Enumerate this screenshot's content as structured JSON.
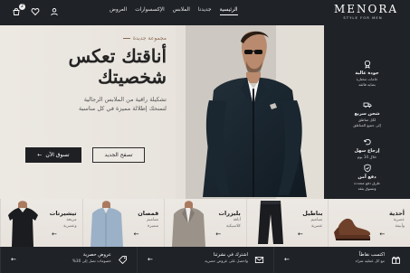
{
  "header": {
    "brand_name": "MENORA",
    "brand_tagline": "STYLE FOR MEN",
    "nav": [
      {
        "label": "الرئيسية",
        "active": true
      },
      {
        "label": "جديدنا",
        "active": false
      },
      {
        "label": "الملابس",
        "active": false
      },
      {
        "label": "الإكسسوارات",
        "active": false
      },
      {
        "label": "العروض",
        "active": false
      }
    ],
    "icons": {
      "cart": "cart-icon",
      "wishlist": "heart-icon",
      "account": "user-icon"
    },
    "cart_count": "2"
  },
  "hero": {
    "eyebrow": "مجموعة جديدة",
    "title_line1": "أناقتك تعكس",
    "title_line2": "شخصيتك",
    "subtitle_line1": "تشكيلة راقية من الملابس الرجالية",
    "subtitle_line2": "لتمنحك إطلالة مميزة في كل مناسبة",
    "primary_button": "تسوق الآن",
    "secondary_button": "تصفح الجديد"
  },
  "features": [
    {
      "title": "جودة عالية",
      "desc_line1": "خامات مختارة",
      "desc_line2": "بعناية فائقة",
      "icon": "badge-icon"
    },
    {
      "title": "شحن سريع",
      "desc_line1": "لكل مناطق",
      "desc_line2": "إلى جميع المناطق",
      "icon": "truck-icon"
    },
    {
      "title": "إرجاع سهل",
      "desc_line1": "خلال 14 يوم",
      "desc_line2": "",
      "icon": "return-icon"
    },
    {
      "title": "دفع آمن",
      "desc_line1": "طرق دفع متعددة",
      "desc_line2": "وتسوق بثقة",
      "icon": "secure-payment-icon"
    }
  ],
  "categories": [
    {
      "title": "أحذية",
      "sub_line1": "عصرية",
      "sub_line2": "وأنيقة",
      "art": "shoe"
    },
    {
      "title": "بناطيل",
      "sub_line1": "تصاميم",
      "sub_line2": "عصرية",
      "art": "pants"
    },
    {
      "title": "بليزرات",
      "sub_line1": "أناقة",
      "sub_line2": "كلاسيكية",
      "art": "blazer"
    },
    {
      "title": "قمصان",
      "sub_line1": "تصاميم",
      "sub_line2": "متميزة",
      "art": "shirt"
    },
    {
      "title": "تيشيرتات",
      "sub_line1": "مريحة",
      "sub_line2": "وعصرية",
      "art": "tshirt"
    }
  ],
  "bottom_bar": [
    {
      "title": "اكتسب نقاطاً",
      "desc": "مع كل عملية شراء",
      "icon": "gift-icon"
    },
    {
      "title": "اشترك في نشرتنا",
      "desc": "واحصل على عروض حصرية",
      "icon": "mail-icon"
    },
    {
      "title": "عروض حصرية",
      "desc": "خصومات تصل إلى 30%",
      "icon": "tag-icon"
    }
  ],
  "colors": {
    "dark": "#1f2227",
    "accent": "#8c6b53",
    "light_bg": "#efebe6"
  }
}
